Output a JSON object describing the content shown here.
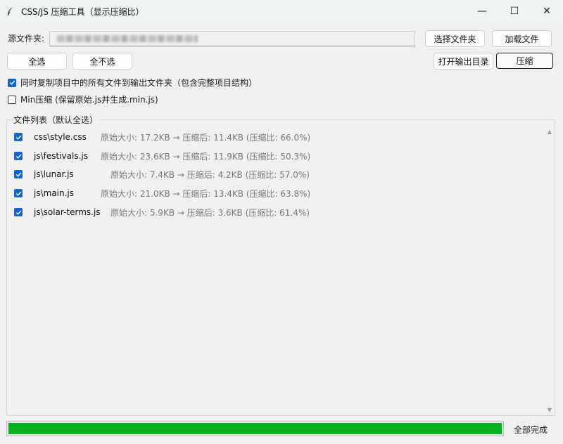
{
  "window": {
    "title": "CSS/JS 压缩工具（显示压缩比）",
    "controls": {
      "minimize": "—",
      "maximize": "☐",
      "close": "✕"
    }
  },
  "source": {
    "label": "源文件夹:",
    "path_value_redacted": true
  },
  "buttons": {
    "select_folder": "选择文件夹",
    "load_files": "加载文件",
    "select_all": "全选",
    "select_none": "全不选",
    "open_output": "打开输出目录",
    "compress": "压缩"
  },
  "options": {
    "copy_all": {
      "label": "同时复制项目中的所有文件到输出文件夹（包含完整项目结构）",
      "checked": true
    },
    "min_compress": {
      "label": "Min压缩 (保留原始.js并生成.min.js)",
      "checked": false
    }
  },
  "file_list": {
    "title": "文件列表（默认全选）",
    "files": [
      {
        "name": "css\\style.css",
        "info": "原始大小: 17.2KB → 压缩后: 11.4KB (压缩比: 66.0%)",
        "checked": true
      },
      {
        "name": "js\\festivals.js",
        "info": "原始大小: 23.6KB → 压缩后: 11.9KB (压缩比: 50.3%)",
        "checked": true
      },
      {
        "name": "js\\lunar.js",
        "info": "原始大小: 7.4KB → 压缩后: 4.2KB (压缩比: 57.0%)",
        "checked": true
      },
      {
        "name": "js\\main.js",
        "info": "原始大小: 21.0KB → 压缩后: 13.4KB (压缩比: 63.8%)",
        "checked": true
      },
      {
        "name": "js\\solar-terms.js",
        "info": "原始大小: 5.9KB → 压缩后: 3.6KB (压缩比: 61.4%)",
        "checked": true
      }
    ]
  },
  "progress": {
    "percent": 100,
    "status": "全部完成"
  },
  "colors": {
    "accent": "#1565c8",
    "progress": "#06b025"
  }
}
